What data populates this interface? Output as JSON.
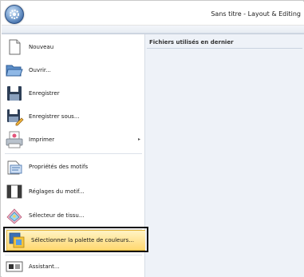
{
  "window": {
    "title": "Sans titre - Layout & Editing"
  },
  "recent": {
    "header": "Fichiers utilisés en dernier"
  },
  "menu": {
    "items": [
      {
        "id": "nouveau",
        "label": "Nouveau",
        "icon": "new-document-icon"
      },
      {
        "id": "ouvrir",
        "label": "Ouvrir...",
        "icon": "open-folder-icon"
      },
      {
        "id": "enregistrer",
        "label": "Enregistrer",
        "icon": "save-icon"
      },
      {
        "id": "enregistrer-sous",
        "label": "Enregistrer sous...",
        "icon": "save-as-icon"
      },
      {
        "id": "imprimer",
        "label": "Imprimer",
        "icon": "printer-icon",
        "submenu": true,
        "arrow": "▸"
      },
      {
        "id": "proprietes-motifs",
        "label": "Propriétés des motifs",
        "icon": "design-properties-icon"
      },
      {
        "id": "reglages-motif",
        "label": "Réglages du motif...",
        "icon": "design-settings-icon"
      },
      {
        "id": "selecteur-tissu",
        "label": "Sélecteur de tissu...",
        "icon": "fabric-selector-icon"
      },
      {
        "id": "palette-couleurs",
        "label": "Sélectionner la palette de couleurs...",
        "icon": "color-palette-icon",
        "selected": true
      },
      {
        "id": "assistant",
        "label": "Assistant...",
        "icon": "wizard-icon"
      }
    ]
  },
  "colors": {
    "selected_fill": "#ffd870",
    "selected_border": "#e2b53a",
    "app_button": "#3e6aa6"
  }
}
